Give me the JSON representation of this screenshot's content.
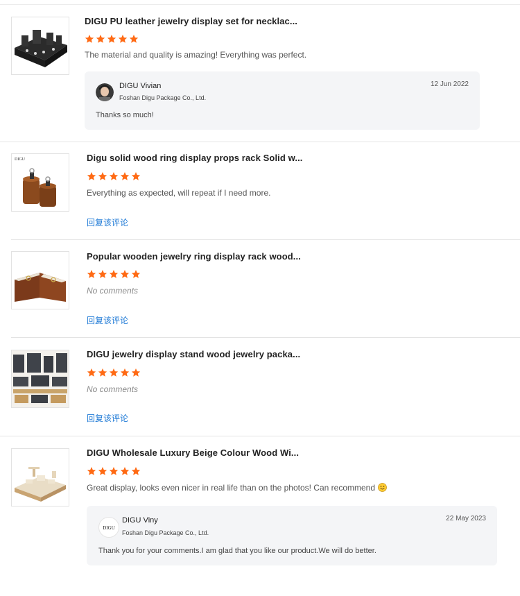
{
  "reviews": [
    {
      "title": "DIGU PU leather jewelry display set for necklac...",
      "rating": 5,
      "comment": "The material and quality is amazing! Everything was perfect.",
      "reply": {
        "seller_name": "DIGU Vivian",
        "company": "Foshan Digu Package Co., Ltd.",
        "date": "12 Jun 2022",
        "text": "Thanks so much!"
      }
    },
    {
      "title": "Digu solid wood ring display props rack Solid w...",
      "rating": 5,
      "comment": "Everything as expected, will repeat if I need more.",
      "thumb_text": "DIGU",
      "reply_link": "回复该评论"
    },
    {
      "title": "Popular wooden jewelry ring display rack wood...",
      "rating": 5,
      "no_comment": "No comments",
      "reply_link": "回复该评论"
    },
    {
      "title": "DIGU jewelry display stand wood jewelry packa...",
      "rating": 5,
      "no_comment": "No comments",
      "reply_link": "回复该评论"
    },
    {
      "title": "DIGU Wholesale Luxury Beige Colour Wood Wi...",
      "rating": 5,
      "comment": "Great display, looks even nicer in real life than on the photos! Can recommend",
      "comment_emoji": "smiley-emoji",
      "reply": {
        "seller_name": "DIGU Viny",
        "company": "Foshan Digu Package Co., Ltd.",
        "date": "22 May 2023",
        "text": "Thank you for your comments.I am glad that you like our product.We will do better.",
        "avatar_text": "DIGU"
      }
    }
  ],
  "colors": {
    "star": "#ff6a14",
    "link": "#1f7ad6",
    "reply_bg": "#f4f5f7"
  },
  "icons": [
    "star-icon",
    "smiley-emoji",
    "avatar"
  ]
}
